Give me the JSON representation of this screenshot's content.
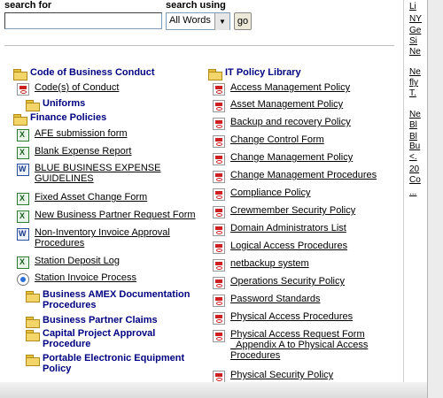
{
  "search": {
    "search_for_label": "search for",
    "search_using_label": "search using",
    "mode_value": "All Words",
    "go_label": "go"
  },
  "left": {
    "code_header": "Code of Business Conduct",
    "code_items": [
      "Code(s) of Conduct"
    ],
    "uniforms": "Uniforms",
    "finance_header": "Finance Policies",
    "finance_items": [
      "AFE submission form",
      "Blank Expense Report",
      "BLUE BUSINESS EXPENSE",
      "GUIDELINES",
      "Fixed Asset Change Form",
      "New Business Partner Request Form",
      "Non-Inventory Invoice Approval",
      "Procedures",
      "Station Deposit Log",
      "Station Invoice Process"
    ],
    "subfolders": [
      "Business AMEX Documentation",
      "Procedures",
      "Business Partner Claims",
      "Capital Project Approval",
      "Procedure",
      "Portable Electronic Equipment",
      "Policy"
    ]
  },
  "right": {
    "it_header": "IT Policy Library",
    "items": [
      "Access Management Policy",
      "Asset Management Policy",
      "Backup and recovery Policy",
      "Change Control Form",
      "Change Management Policy",
      "Change Management Procedures",
      "Compliance Policy",
      "Crewmember Security Policy",
      "Domain Administrators List",
      "Logical Access Procedures",
      "netbackup system",
      "Operations Security Policy",
      "Password Standards",
      "Physical Access Procedures",
      "Physical Access Request Form",
      "_Appendix A to Physical Access",
      "Procedures",
      "Physical Security Policy"
    ]
  },
  "side": {
    "lines": [
      "Li",
      "NY",
      "Ge",
      "Si",
      "Ne",
      "Ne",
      "fly",
      "T.",
      "Ne",
      "Bl",
      "Bl",
      "Bu",
      "<.",
      "20",
      "Co",
      "..."
    ]
  }
}
